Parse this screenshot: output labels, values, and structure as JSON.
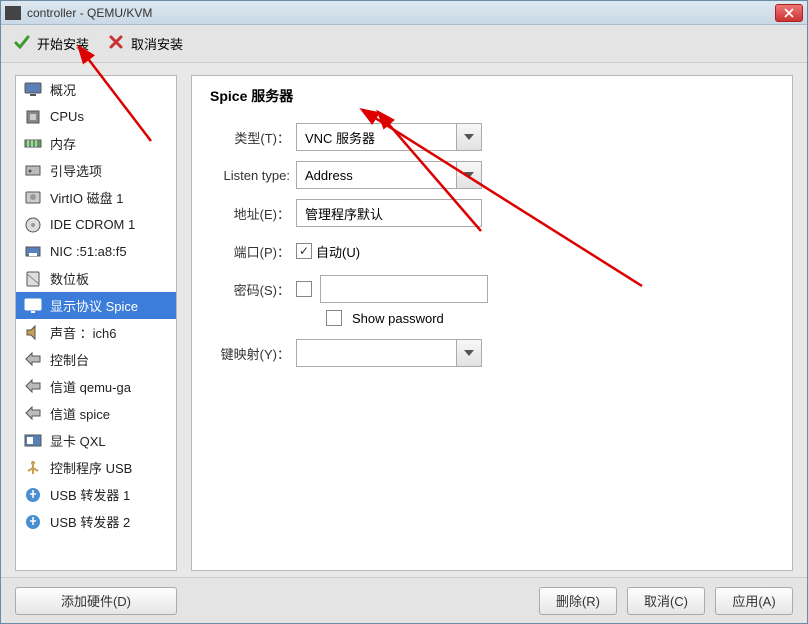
{
  "window": {
    "title": "controller - QEMU/KVM"
  },
  "toolbar": {
    "begin_install": "开始安装",
    "cancel_install": "取消安装"
  },
  "sidebar": {
    "items": [
      {
        "label": "概况",
        "icon": "monitor"
      },
      {
        "label": "CPUs",
        "icon": "cpu"
      },
      {
        "label": "内存",
        "icon": "memory"
      },
      {
        "label": "引导选项",
        "icon": "boot"
      },
      {
        "label": "VirtIO 磁盘 1",
        "icon": "disk"
      },
      {
        "label": "IDE CDROM 1",
        "icon": "cdrom"
      },
      {
        "label": "NIC :51:a8:f5",
        "icon": "nic"
      },
      {
        "label": "数位板",
        "icon": "tablet"
      },
      {
        "label": "显示协议 Spice",
        "icon": "display"
      },
      {
        "label": "声音 ：ich6",
        "icon": "sound"
      },
      {
        "label": "控制台",
        "icon": "console"
      },
      {
        "label": "信道 qemu-ga",
        "icon": "channel"
      },
      {
        "label": "信道 spice",
        "icon": "channel"
      },
      {
        "label": "显卡 QXL",
        "icon": "video"
      },
      {
        "label": "控制程序 USB",
        "icon": "usb-ctrl"
      },
      {
        "label": "USB 转发器 1",
        "icon": "usb-redir"
      },
      {
        "label": "USB 转发器 2",
        "icon": "usb-redir"
      }
    ],
    "selected_index": 8,
    "add_hw": "添加硬件(D)"
  },
  "panel": {
    "title": "Spice 服务器",
    "type_label": "类型(T)：",
    "type_value": "VNC 服务器",
    "listen_label": "Listen type:",
    "listen_value": "Address",
    "address_label": "地址(E)：",
    "address_value": "管理程序默认",
    "port_label": "端口(P)：",
    "port_auto": "自动(U)",
    "port_auto_checked": true,
    "password_label": "密码(S)：",
    "password_checked": false,
    "show_password": "Show password",
    "keymap_label": "键映射(Y)：",
    "keymap_value": ""
  },
  "footer": {
    "delete": "删除(R)",
    "cancel": "取消(C)",
    "apply": "应用(A)"
  }
}
